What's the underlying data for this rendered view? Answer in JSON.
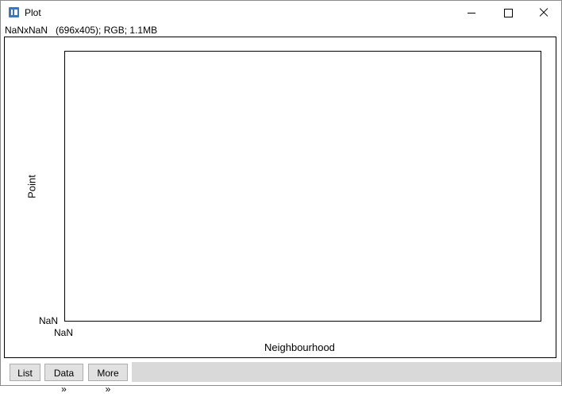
{
  "window": {
    "title": "Plot",
    "icon": "imagej-icon",
    "controls": [
      "minimize-icon",
      "maximize-icon",
      "close-icon"
    ]
  },
  "info_line": "NaNxNaN   (696x405); RGB; 1.1MB",
  "plot": {
    "xlabel": "Neighbourhood",
    "ylabel": "Point",
    "x_tick": "NaN",
    "y_tick": "NaN"
  },
  "toolbar": {
    "list_label": "List",
    "data_label": "Data »",
    "more_label": "More »"
  }
}
